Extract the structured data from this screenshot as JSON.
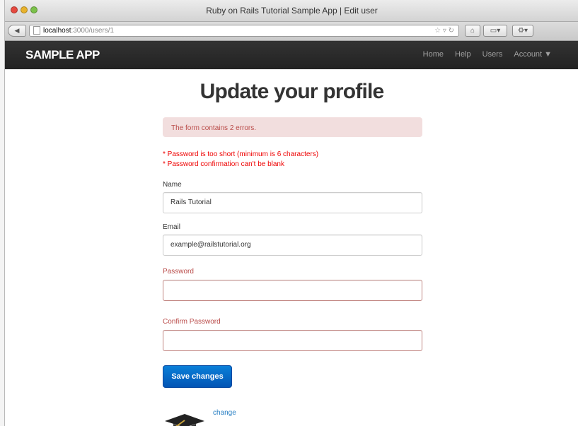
{
  "browser": {
    "window_title": "Ruby on Rails Tutorial Sample App | Edit user",
    "url_host": "localhost",
    "url_path": ":3000/users/1"
  },
  "navbar": {
    "logo": "SAMPLE APP",
    "links": [
      "Home",
      "Help",
      "Users",
      "Account"
    ]
  },
  "page": {
    "title": "Update your profile",
    "error_summary": "The form contains 2 errors.",
    "errors": [
      "* Password is too short (minimum is 6 characters)",
      "* Password confirmation can't be blank"
    ],
    "form": {
      "name_label": "Name",
      "name_value": "Rails Tutorial",
      "email_label": "Email",
      "email_value": "example@railstutorial.org",
      "password_label": "Password",
      "password_value": "",
      "confirm_label": "Confirm Password",
      "confirm_value": "",
      "submit_label": "Save changes"
    },
    "gravatar_change_label": "change"
  },
  "colors": {
    "error_text": "#b94a48",
    "alert_bg": "#f2dede",
    "primary_button": "#0063c6",
    "navbar_bg": "#222222"
  }
}
